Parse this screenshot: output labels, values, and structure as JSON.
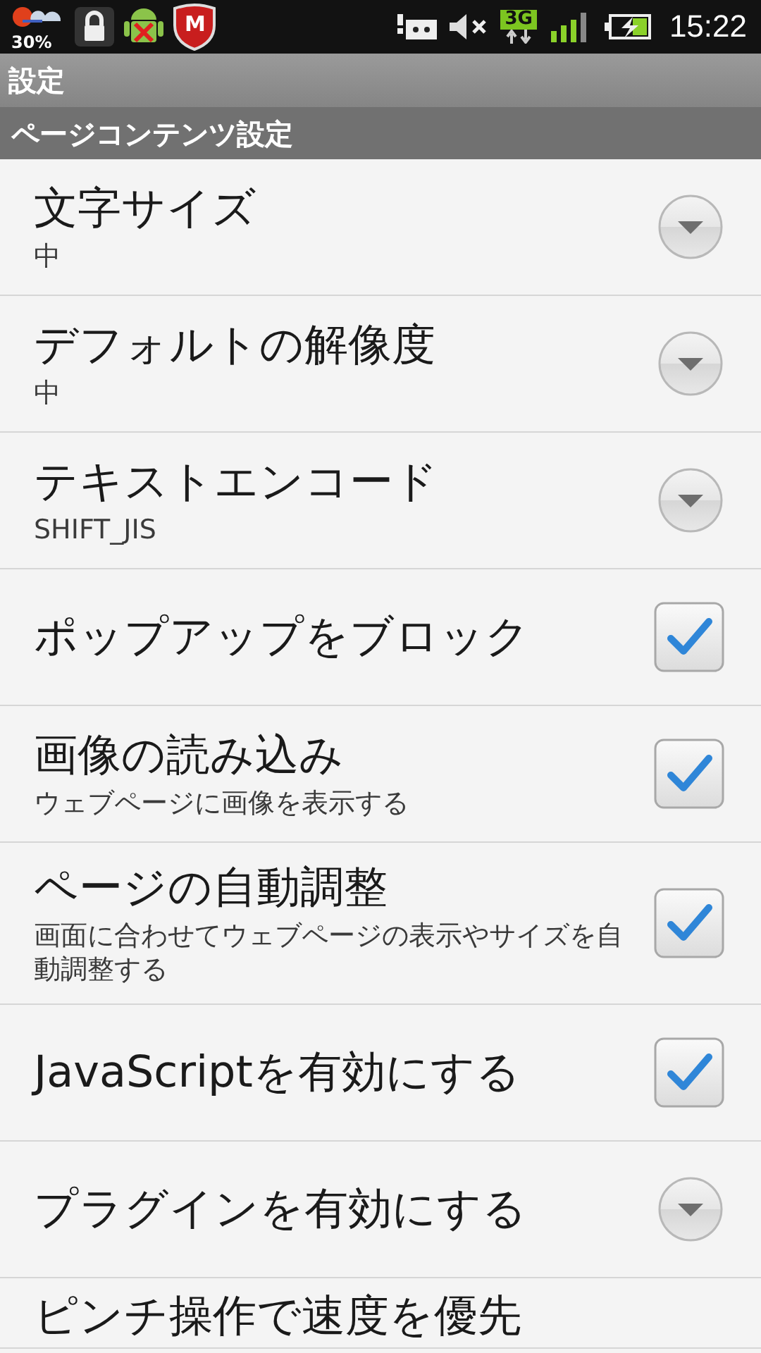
{
  "status_bar": {
    "weather_reading": "30%",
    "shield_letter": "M",
    "network": "3G",
    "time": "15:22"
  },
  "title_bar": {
    "title": "設定"
  },
  "section": {
    "title": "ページコンテンツ設定"
  },
  "items": [
    {
      "kind": "list",
      "title": "文字サイズ",
      "summary": "中"
    },
    {
      "kind": "list",
      "title": "デフォルトの解像度",
      "summary": "中"
    },
    {
      "kind": "list",
      "title": "テキストエンコード",
      "summary": "SHIFT_JIS"
    },
    {
      "kind": "checkbox",
      "title": "ポップアップをブロック",
      "checked": true
    },
    {
      "kind": "checkbox",
      "title": "画像の読み込み",
      "summary": "ウェブページに画像を表示する",
      "checked": true
    },
    {
      "kind": "checkbox",
      "title": "ページの自動調整",
      "summary": "画面に合わせてウェブページの表示やサイズを自動調整する",
      "checked": true
    },
    {
      "kind": "checkbox",
      "title": "JavaScriptを有効にする",
      "checked": true
    },
    {
      "kind": "list",
      "title": "プラグインを有効にする"
    },
    {
      "kind": "cut",
      "title": "ピンチ操作で速度を優先"
    }
  ]
}
